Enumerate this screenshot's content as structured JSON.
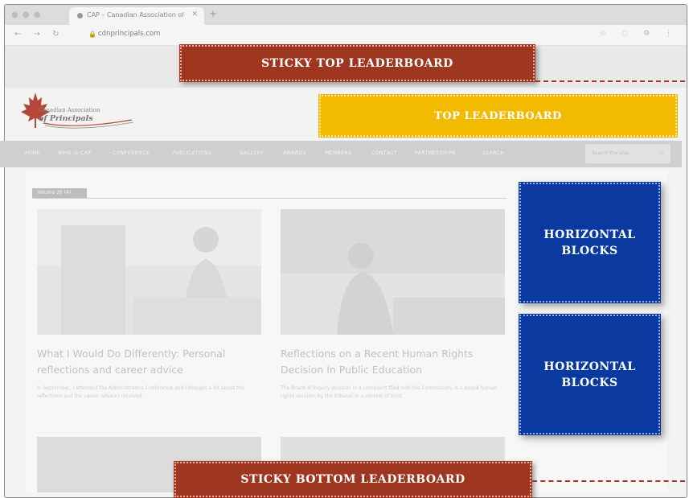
{
  "browser": {
    "window_controls": "● ● ●",
    "tab_title": "CAP – Canadian Association of Principals",
    "tab_close": "✕",
    "new_tab": "+",
    "nav_buttons": "← → ↻",
    "lock": "🔒",
    "url": "cdnprincipals.com",
    "right_icons": "☆ ◌ ⚙ ⋮"
  },
  "logo": {
    "line1": "Canadian Association",
    "line2": "of Principals"
  },
  "nav": {
    "items": [
      "HOME",
      "WHO IS CAP",
      "CONFERENCE",
      "PUBLICATIONS",
      "GALLERY",
      "AWARDS",
      "MEMBERS",
      "CONTACT",
      "PARTNERSHIPS",
      "SEARCH"
    ],
    "search_placeholder": "Search the site..."
  },
  "category_label": "Volume 26 (4)",
  "articles": [
    {
      "headline": "What I Would Do Differently: Personal reflections and career advice",
      "excerpt": "In September, I attended the Administrators Conference and I thought a lot about the reflections and the career advice I received."
    },
    {
      "headline": "Reflections on a Recent Human Rights Decision In Public Education",
      "excerpt": "The Board of Inquiry decision in a complaint filed with the Commission, is a sound human rights decision by the tribunal in a context of trust."
    }
  ],
  "ads": {
    "sticky_top": "STICKY TOP LEADERBOARD",
    "top": "TOP LEADERBOARD",
    "horizontal_1": "HORIZONTAL BLOCKS",
    "horizontal_2": "HORIZONTAL BLOCKS",
    "sticky_bottom": "STICKY BOTTOM LEADERBOARD"
  },
  "colors": {
    "ad_red": "#9f3620",
    "ad_gold": "#f2ba00",
    "ad_blue": "#0a3aa0",
    "logo_leaf": "#b5473a"
  },
  "icons": [
    "maple-leaf-icon",
    "search-icon",
    "lock-icon",
    "refresh-icon"
  ]
}
